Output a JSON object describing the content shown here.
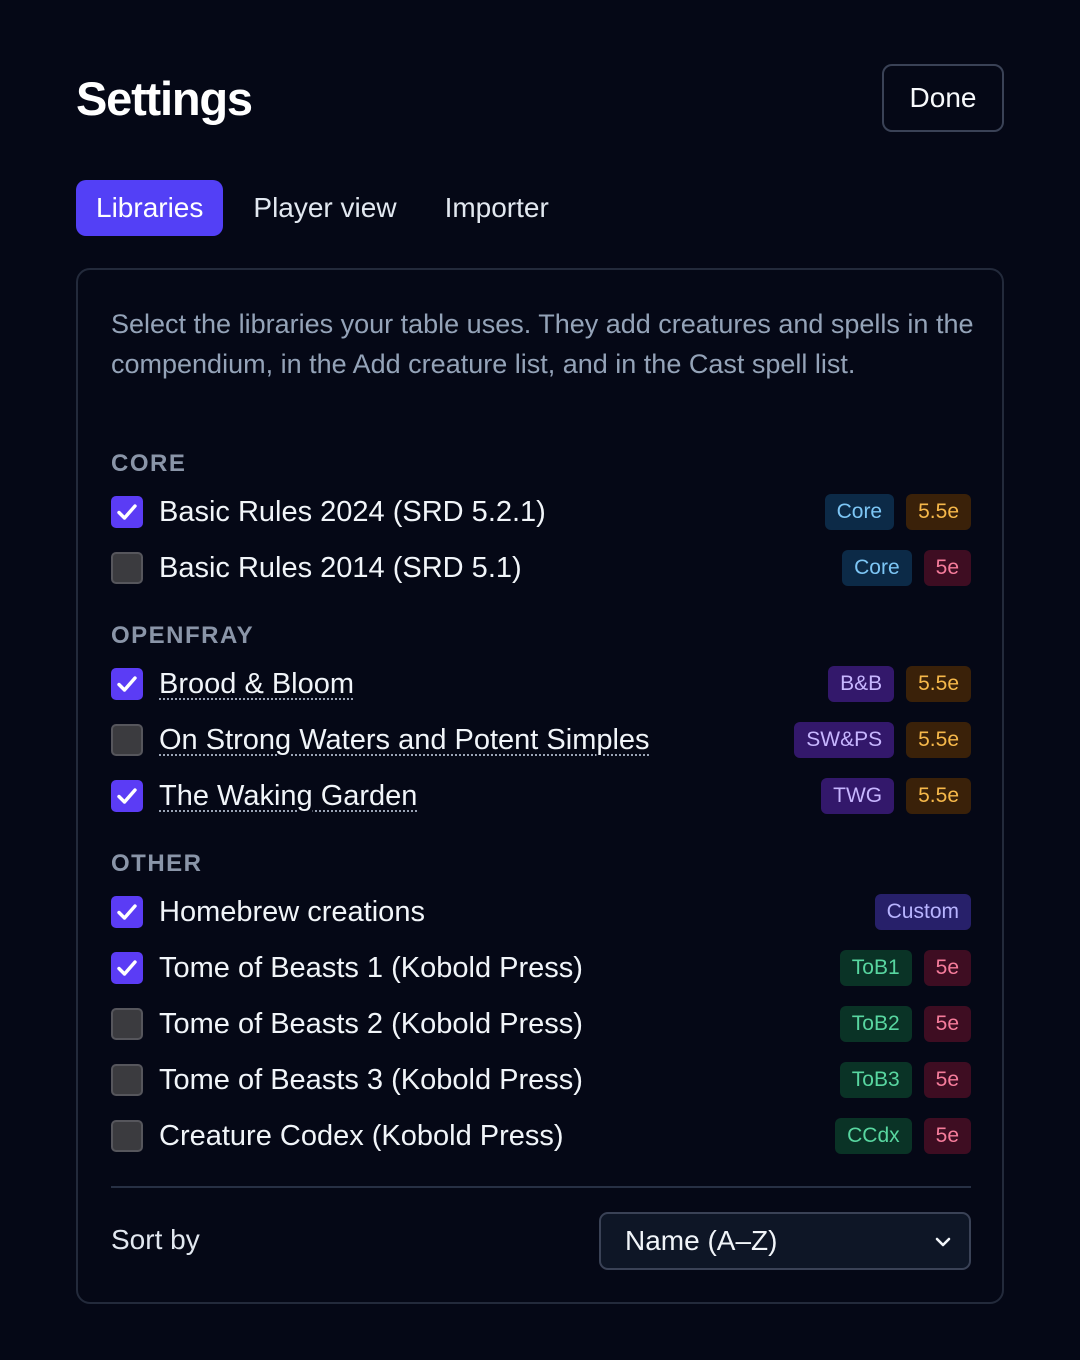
{
  "header": {
    "title": "Settings",
    "done_label": "Done"
  },
  "tabs": [
    {
      "label": "Libraries",
      "active": true
    },
    {
      "label": "Player view",
      "active": false
    },
    {
      "label": "Importer",
      "active": false
    }
  ],
  "intro": "Select the libraries your table uses. They add creatures and spells in the compendium, in the Add creature list, and in the Cast spell list.",
  "sections": {
    "core": {
      "heading": "CORE",
      "items": [
        {
          "label": "Basic Rules 2024 (SRD 5.2.1)",
          "checked": true,
          "badges": [
            "Core",
            "5.5e"
          ]
        },
        {
          "label": "Basic Rules 2014 (SRD 5.1)",
          "checked": false,
          "badges": [
            "Core",
            "5e"
          ]
        }
      ]
    },
    "openfray": {
      "heading": "OPENFRAY",
      "items": [
        {
          "label": "Brood & Bloom",
          "checked": true,
          "badges": [
            "B&B",
            "5.5e"
          ]
        },
        {
          "label": "On Strong Waters and Potent Simples",
          "checked": false,
          "badges": [
            "SW&PS",
            "5.5e"
          ]
        },
        {
          "label": "The Waking Garden",
          "checked": true,
          "badges": [
            "TWG",
            "5.5e"
          ]
        }
      ]
    },
    "other": {
      "heading": "OTHER",
      "items": [
        {
          "label": "Homebrew creations",
          "checked": true,
          "badges": [
            "Custom"
          ]
        },
        {
          "label": "Tome of Beasts 1 (Kobold Press)",
          "checked": true,
          "badges": [
            "ToB1",
            "5e"
          ]
        },
        {
          "label": "Tome of Beasts 2 (Kobold Press)",
          "checked": false,
          "badges": [
            "ToB2",
            "5e"
          ]
        },
        {
          "label": "Tome of Beasts 3 (Kobold Press)",
          "checked": false,
          "badges": [
            "ToB3",
            "5e"
          ]
        },
        {
          "label": "Creature Codex (Kobold Press)",
          "checked": false,
          "badges": [
            "CCdx",
            "5e"
          ]
        }
      ]
    }
  },
  "sort": {
    "label": "Sort by",
    "value": "Name (A–Z)"
  },
  "colors": {
    "accent": "#5340f6",
    "background": "#050816",
    "checkbox_on": "#5b3cf5"
  },
  "icons": {
    "checkmark": "check-icon",
    "select_chevron": "chevron-down-icon"
  }
}
